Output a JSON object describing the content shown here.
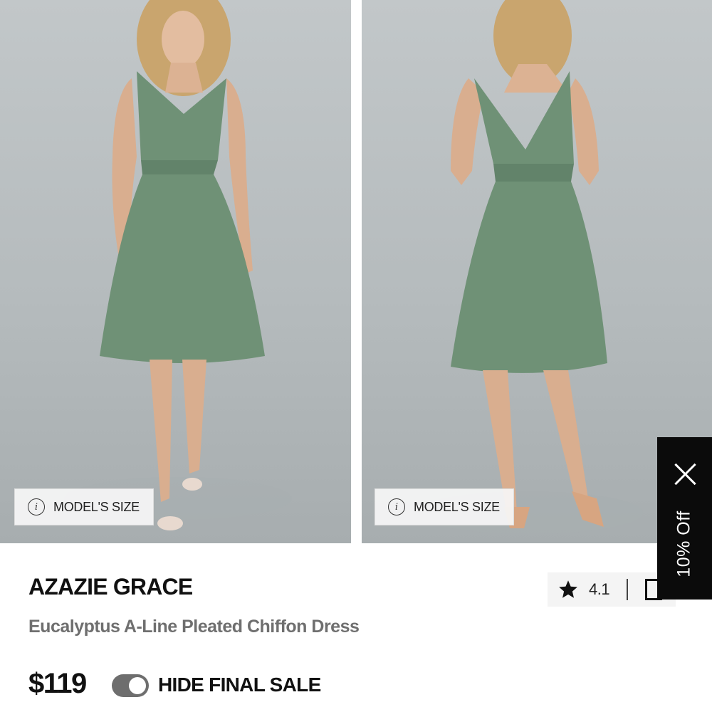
{
  "product": {
    "brand": "AZAZIE GRACE",
    "name": "Eucalyptus A-Line Pleated Chiffon Dress",
    "price": "$119"
  },
  "gallery": {
    "model_size_label_1": "MODEL'S SIZE",
    "model_size_label_2": "MODEL'S SIZE"
  },
  "rating": {
    "value": "4.1"
  },
  "filters": {
    "hide_final_sale_label": "HIDE FINAL SALE",
    "hide_final_sale_on": true
  },
  "promo": {
    "label": "10% Off"
  },
  "icons": {
    "info": "info-icon",
    "star": "star-icon",
    "close": "close-icon",
    "save": "bookmark-icon"
  },
  "colors": {
    "dress": "#6f9176",
    "toggle": "#6e6e6e",
    "promo_bg": "#0b0b0b",
    "product_name": "#6f6f6f"
  }
}
